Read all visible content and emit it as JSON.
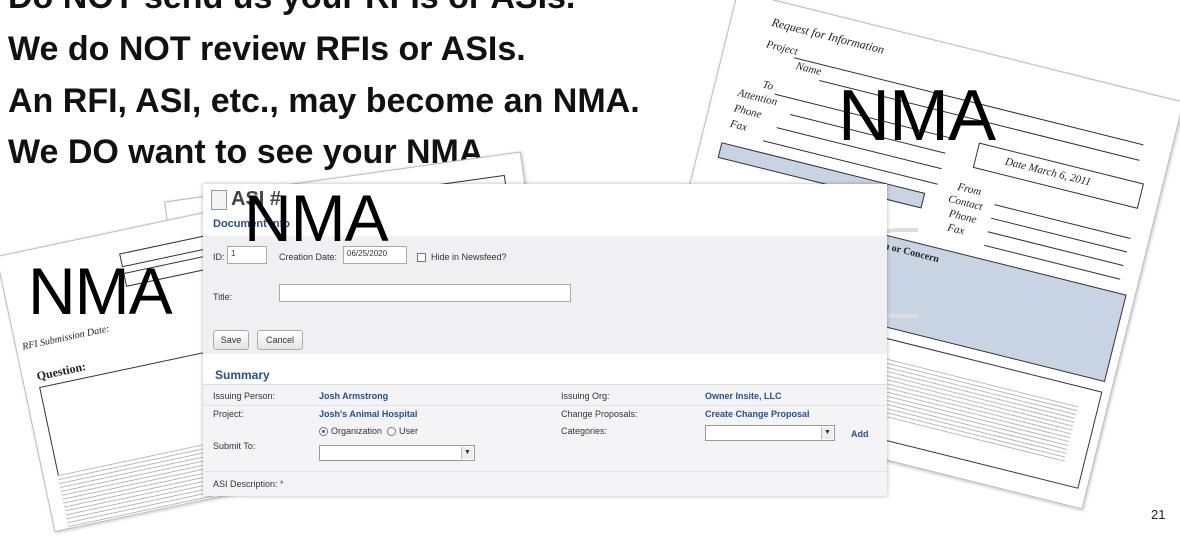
{
  "headline": [
    "Do NOT send us your RFIs or ASIs.",
    "We do NOT review RFIs or ASIs.",
    "An RFI, ASI, etc., may become an NMA.",
    "We DO want to see your NMA."
  ],
  "stamps": {
    "left": "NMA",
    "center": "NMA",
    "right": "NMA"
  },
  "rfi_sheet": {
    "title": "Request for Information",
    "fields": [
      "Project",
      "Name",
      "To",
      "Attention",
      "Phone",
      "Fax",
      "From",
      "Contact",
      "Phone",
      "Fax"
    ],
    "date_label": "Date  March 6, 2011",
    "section": "Question or Concern"
  },
  "left_sheet": {
    "labels": [
      "RFI Submission Date:",
      "Question:"
    ]
  },
  "form": {
    "title": "ASI #",
    "section": "Document Info",
    "id_label": "ID:",
    "id_value": "1",
    "creation_label": "Creation Date:",
    "creation_value": "06/25/2020",
    "hide_label": "Hide in Newsfeed?",
    "title_label": "Title:",
    "title_value": "",
    "save_label": "Save",
    "cancel_label": "Cancel"
  },
  "summary": {
    "heading": "Summary",
    "issuing_person_label": "Issuing Person:",
    "issuing_person_value": "Josh Armstrong",
    "project_label": "Project:",
    "project_value": "Josh's Animal Hospital",
    "radio_org": "Organization",
    "radio_user": "User",
    "submit_to_label": "Submit To:",
    "issuing_org_label": "Issuing Org:",
    "issuing_org_value": "Owner Insite, LLC",
    "change_proposals_label": "Change Proposals:",
    "change_proposals_value": "Create Change Proposal",
    "categories_label": "Categories:",
    "add_label": "Add",
    "description_label": "ASI Description:",
    "required_mark": "*"
  },
  "page_number": "21"
}
